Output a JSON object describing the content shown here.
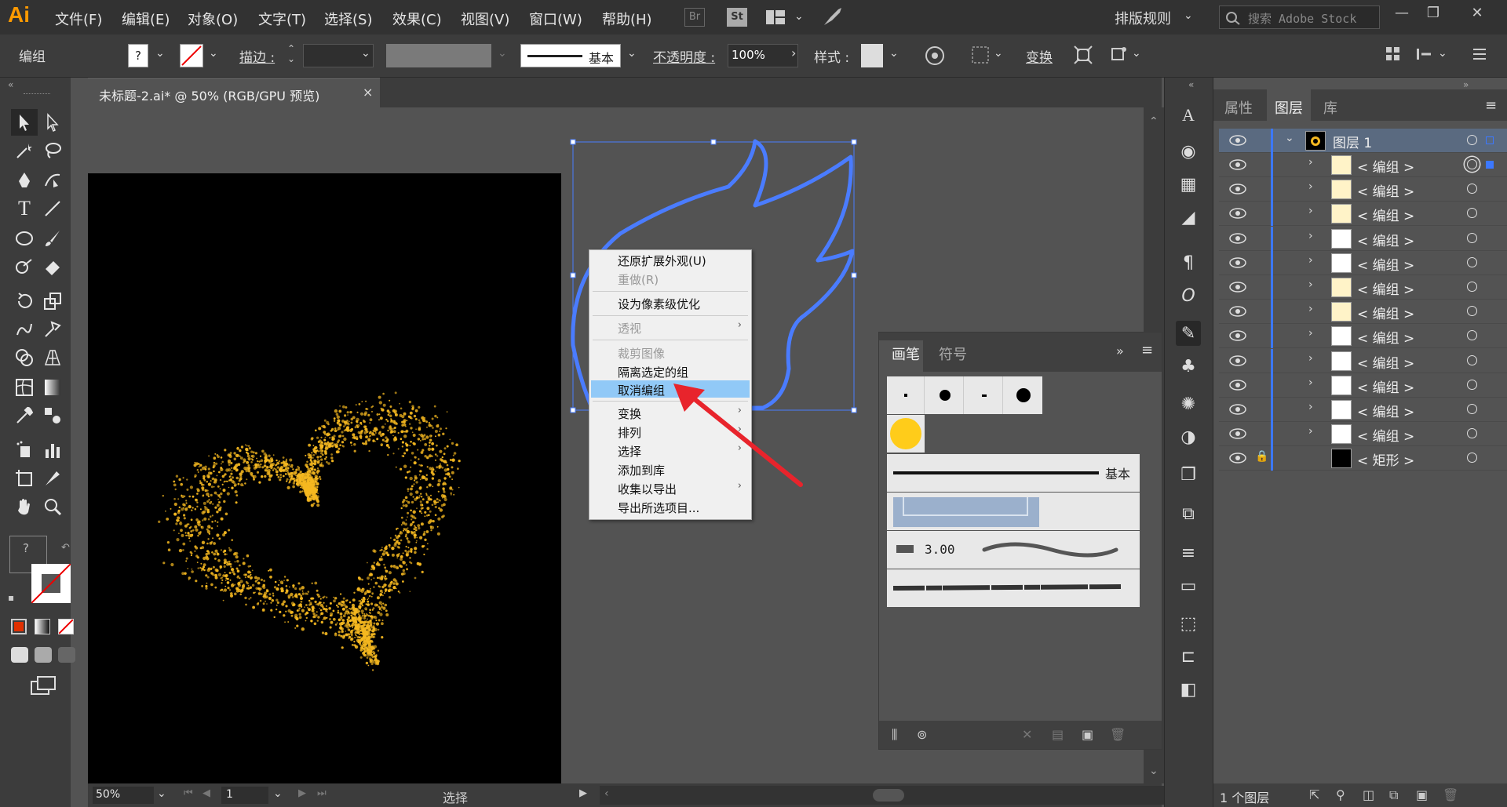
{
  "app": {
    "logo": "Ai"
  },
  "menu": [
    "文件(F)",
    "编辑(E)",
    "对象(O)",
    "文字(T)",
    "选择(S)",
    "效果(C)",
    "视图(V)",
    "窗口(W)",
    "帮助(H)"
  ],
  "menu_badges": [
    "Br",
    "St"
  ],
  "workspace": {
    "label": "排版规则",
    "search_placeholder": "搜索 Adobe Stock"
  },
  "control": {
    "selection_label": "编组",
    "stroke_label": "描边 :",
    "stroke_style": "基本",
    "opacity_label": "不透明度 :",
    "opacity_value": "100%",
    "style_label": "样式 :",
    "transform_label": "变换"
  },
  "document": {
    "tab_title": "未标题-2.ai* @ 50% (RGB/GPU 预览)",
    "close": "×"
  },
  "status": {
    "zoom": "50%",
    "page": "1",
    "mode": "选择"
  },
  "context_menu": {
    "items": [
      {
        "label": "还原扩展外观(U)",
        "disabled": false,
        "submenu": false
      },
      {
        "label": "重做(R)",
        "disabled": true,
        "submenu": false
      },
      {
        "label": "设为像素级优化",
        "disabled": false,
        "submenu": false
      },
      {
        "label": "透视",
        "disabled": true,
        "submenu": true
      },
      {
        "label": "裁剪图像",
        "disabled": true,
        "submenu": false
      },
      {
        "label": "隔离选定的组",
        "disabled": false,
        "submenu": false
      },
      {
        "label": "取消编组",
        "disabled": false,
        "submenu": false,
        "highlighted": true
      },
      {
        "label": "变换",
        "disabled": false,
        "submenu": true
      },
      {
        "label": "排列",
        "disabled": false,
        "submenu": true
      },
      {
        "label": "选择",
        "disabled": false,
        "submenu": true
      },
      {
        "label": "添加到库",
        "disabled": false,
        "submenu": false
      },
      {
        "label": "收集以导出",
        "disabled": false,
        "submenu": true
      },
      {
        "label": "导出所选项目...",
        "disabled": false,
        "submenu": false
      }
    ]
  },
  "brush_panel": {
    "tabs": [
      "画笔",
      "符号"
    ],
    "basic_label": "基本",
    "size_value": "3.00"
  },
  "layers_panel": {
    "tabs": [
      "属性",
      "图层",
      "库"
    ],
    "layer_name": "图层 1",
    "rows": [
      "< 编组 >",
      "< 编组 >",
      "< 编组 >",
      "< 编组 >",
      "< 编组 >",
      "< 编组 >",
      "< 编组 >",
      "< 编组 >",
      "< 编组 >",
      "< 编组 >",
      "< 编组 >",
      "< 编组 >",
      "< 矩形 >"
    ],
    "footer": "1 个图层"
  },
  "colors": {
    "accent": "#3c78ff",
    "selection_blue": "#4a7cff",
    "highlight": "#91c9f7",
    "particle": "#f5b820",
    "logo": "#ff9a00"
  }
}
